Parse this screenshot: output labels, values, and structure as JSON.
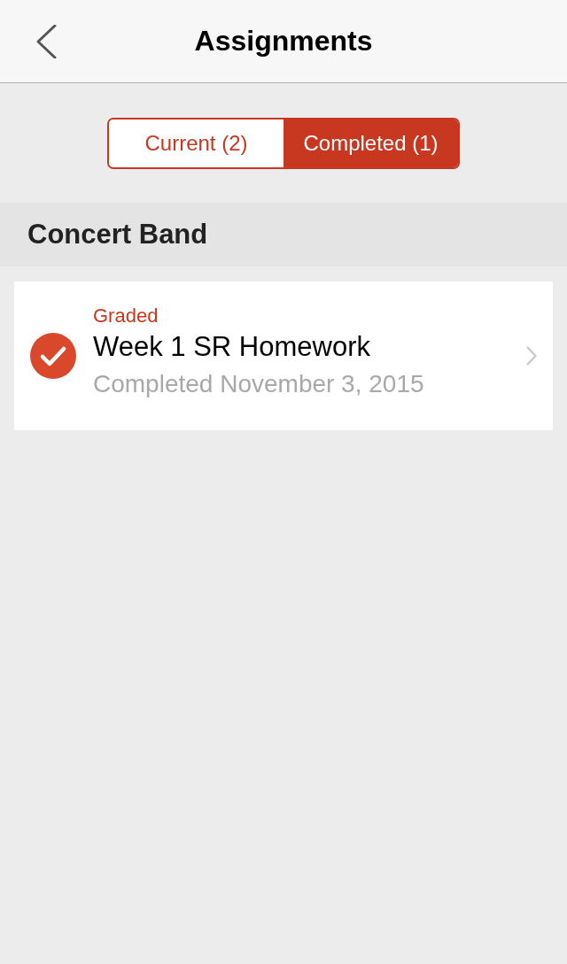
{
  "nav": {
    "title": "Assignments"
  },
  "segments": [
    {
      "label": "Current (2)",
      "selected": false
    },
    {
      "label": "Completed (1)",
      "selected": true
    }
  ],
  "sections": [
    {
      "title": "Concert Band",
      "assignments": [
        {
          "status": "Graded",
          "title": "Week 1 SR Homework",
          "date": "Completed November 3, 2015",
          "completed": true
        }
      ]
    }
  ]
}
